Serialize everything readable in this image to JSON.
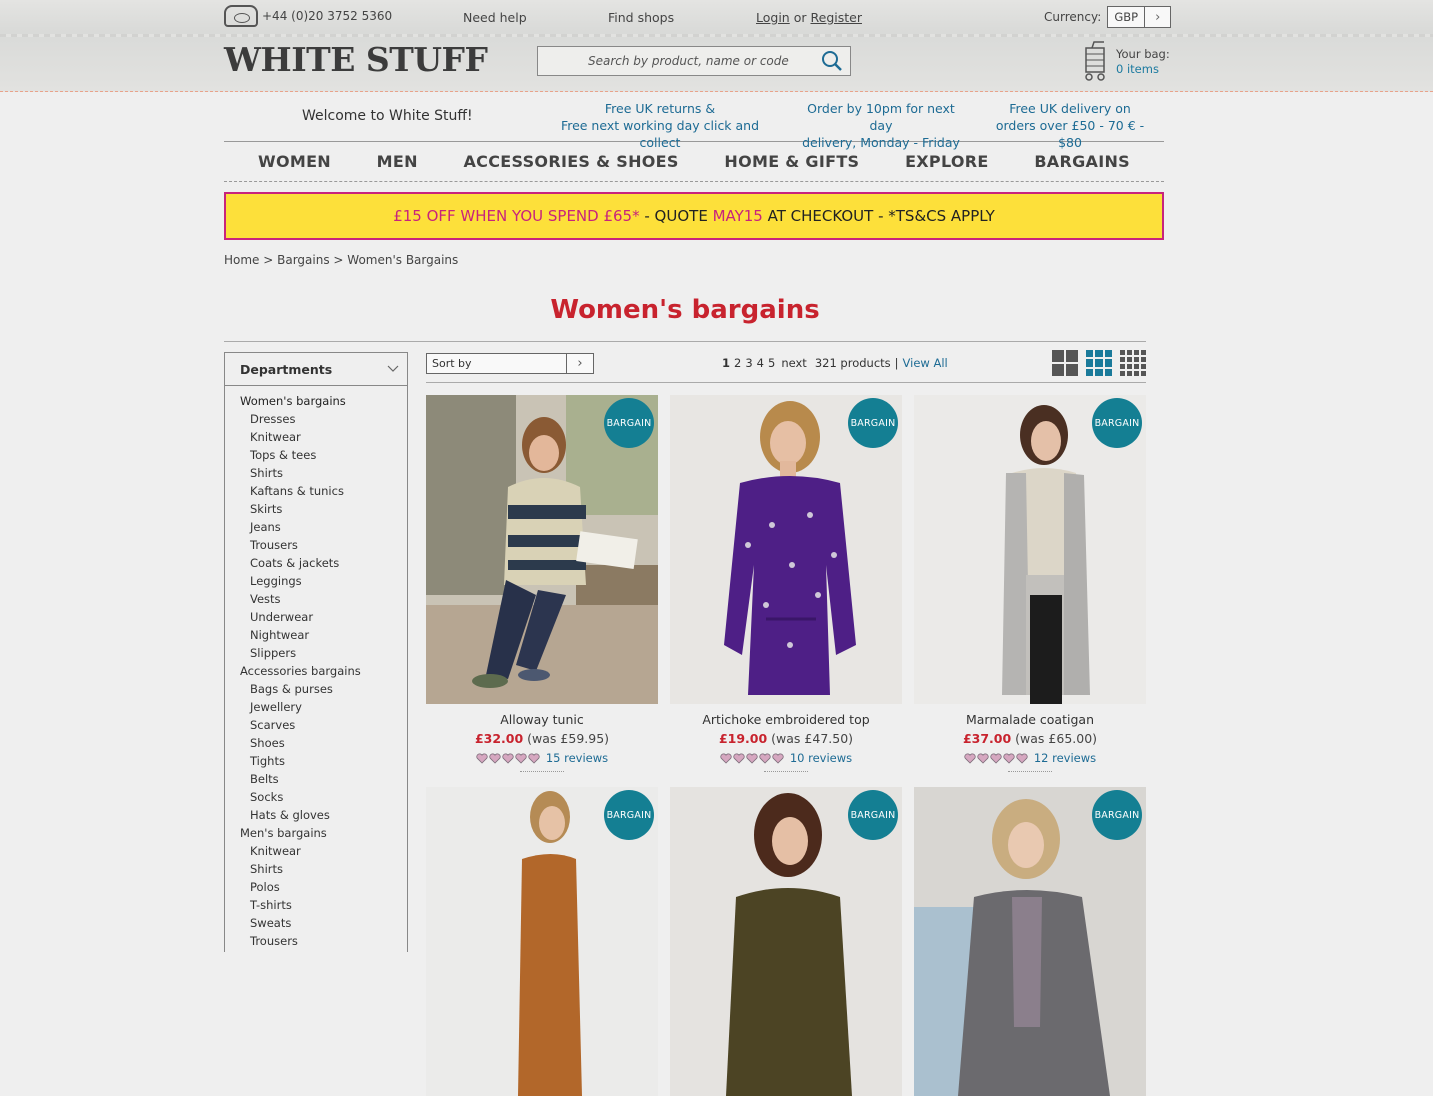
{
  "header": {
    "phone": "+44 (0)20 3752 5360",
    "need_help": "Need help",
    "find_shops": "Find shops",
    "login": "Login",
    "or": "or",
    "register": "Register",
    "currency_label": "Currency:",
    "currency_value": "GBP",
    "logo": "WHITE STUFF",
    "search_placeholder": "Search by product, name or code",
    "bag_label": "Your bag:",
    "bag_count": "0 items"
  },
  "info": {
    "welcome": "Welcome to White Stuff!",
    "returns_line1": "Free UK returns &",
    "returns_line2": "Free next working day click and collect",
    "order_line1": "Order by 10pm for next day",
    "order_line2": "delivery, Monday - Friday",
    "delivery_line1": "Free UK delivery on",
    "delivery_line2": "orders over £50 - 70 € - $80"
  },
  "nav": [
    "WOMEN",
    "MEN",
    "ACCESSORIES & SHOES",
    "HOME & GIFTS",
    "EXPLORE",
    "BARGAINS"
  ],
  "promo": {
    "part1": "£15 OFF WHEN YOU SPEND £65*",
    "part2": " - QUOTE ",
    "code": "MAY15",
    "part3": " AT CHECKOUT - *TS&CS APPLY"
  },
  "breadcrumb": "Home > Bargains > Women's Bargains",
  "page_title": "Women's bargains",
  "sidebar": {
    "heading": "Departments",
    "items": [
      {
        "label": "Women's bargains",
        "level": 1
      },
      {
        "label": "Dresses",
        "level": 2
      },
      {
        "label": "Knitwear",
        "level": 2
      },
      {
        "label": "Tops & tees",
        "level": 2
      },
      {
        "label": "Shirts",
        "level": 2
      },
      {
        "label": "Kaftans & tunics",
        "level": 2
      },
      {
        "label": "Skirts",
        "level": 2
      },
      {
        "label": "Jeans",
        "level": 2
      },
      {
        "label": "Trousers",
        "level": 2
      },
      {
        "label": "Coats & jackets",
        "level": 2
      },
      {
        "label": "Leggings",
        "level": 2
      },
      {
        "label": "Vests",
        "level": 2
      },
      {
        "label": "Underwear",
        "level": 2
      },
      {
        "label": "Nightwear",
        "level": 2
      },
      {
        "label": "Slippers",
        "level": 2
      },
      {
        "label": "Accessories bargains",
        "level": 1
      },
      {
        "label": "Bags & purses",
        "level": 2
      },
      {
        "label": "Jewellery",
        "level": 2
      },
      {
        "label": "Scarves",
        "level": 2
      },
      {
        "label": "Shoes",
        "level": 2
      },
      {
        "label": "Tights",
        "level": 2
      },
      {
        "label": "Belts",
        "level": 2
      },
      {
        "label": "Socks",
        "level": 2
      },
      {
        "label": "Hats & gloves",
        "level": 2
      },
      {
        "label": "Men's bargains",
        "level": 1
      },
      {
        "label": "Knitwear",
        "level": 2
      },
      {
        "label": "Shirts",
        "level": 2
      },
      {
        "label": "Polos",
        "level": 2
      },
      {
        "label": "T-shirts",
        "level": 2
      },
      {
        "label": "Sweats",
        "level": 2
      },
      {
        "label": "Trousers",
        "level": 2
      }
    ]
  },
  "toolbar": {
    "sort_label": "Sort by",
    "pages": [
      "1",
      "2",
      "3",
      "4",
      "5"
    ],
    "next": "next",
    "product_count": "321 products",
    "separator": "|",
    "view_all": "View All"
  },
  "products": [
    {
      "name": "Alloway tunic",
      "price": "£32.00",
      "was": "(was £59.95)",
      "reviews": "15 reviews",
      "badge": "BARGAIN",
      "rating": 5
    },
    {
      "name": "Artichoke embroidered top",
      "price": "£19.00",
      "was": "(was £47.50)",
      "reviews": "10 reviews",
      "badge": "BARGAIN",
      "rating": 5
    },
    {
      "name": "Marmalade coatigan",
      "price": "£37.00",
      "was": "(was £65.00)",
      "reviews": "12 reviews",
      "badge": "BARGAIN",
      "rating": 5
    },
    {
      "name": "",
      "price": "",
      "was": "",
      "reviews": "",
      "badge": "BARGAIN"
    },
    {
      "name": "",
      "price": "",
      "was": "",
      "reviews": "",
      "badge": "BARGAIN"
    },
    {
      "name": "",
      "price": "",
      "was": "",
      "reviews": "",
      "badge": "BARGAIN"
    }
  ],
  "colors": {
    "accent_red": "#c8232e",
    "link_blue": "#1d6b94",
    "badge_teal": "#147f93",
    "promo_yellow": "#fde03a",
    "promo_pink": "#c8247c"
  }
}
